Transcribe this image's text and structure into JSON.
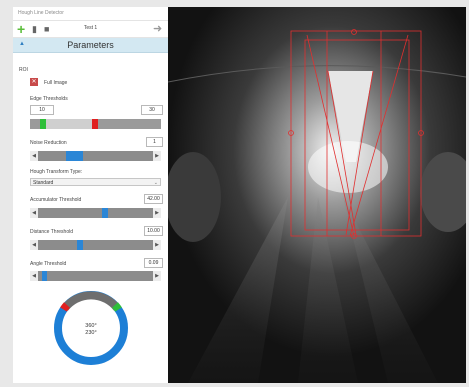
{
  "window": {
    "title": "Hough Line Detector"
  },
  "toolbar": {
    "add_icon": "plus-icon",
    "delete_icon": "trash-icon",
    "lock_icon": "lock-icon",
    "test_label": "Test 1",
    "next_icon": "arrow-right-icon"
  },
  "section": {
    "title": "Parameters"
  },
  "roi": {
    "label": "ROI",
    "checkbox_label": "Full Image",
    "checked": true
  },
  "edge_thresholds": {
    "label": "Edge Thresholds",
    "low": "10",
    "high": "30"
  },
  "noise_reduction": {
    "label": "Noise Reduction",
    "value": "1"
  },
  "transform_type": {
    "label": "Hough Transform Type:",
    "selected": "Standard"
  },
  "accumulator": {
    "label": "Accumulator Threshold",
    "value": "42.00"
  },
  "distance": {
    "label": "Distance Threshold",
    "value": "10.00"
  },
  "angle": {
    "label": "Angle Threshold",
    "value": "0.09"
  },
  "dial": {
    "line1": "360°",
    "line2": "230°"
  },
  "colors": {
    "accent": "#2b86d6",
    "header": "#d3e8f2",
    "edge_low": "#2fbf3a",
    "edge_high": "#e02020",
    "overlay": "#e03030"
  }
}
